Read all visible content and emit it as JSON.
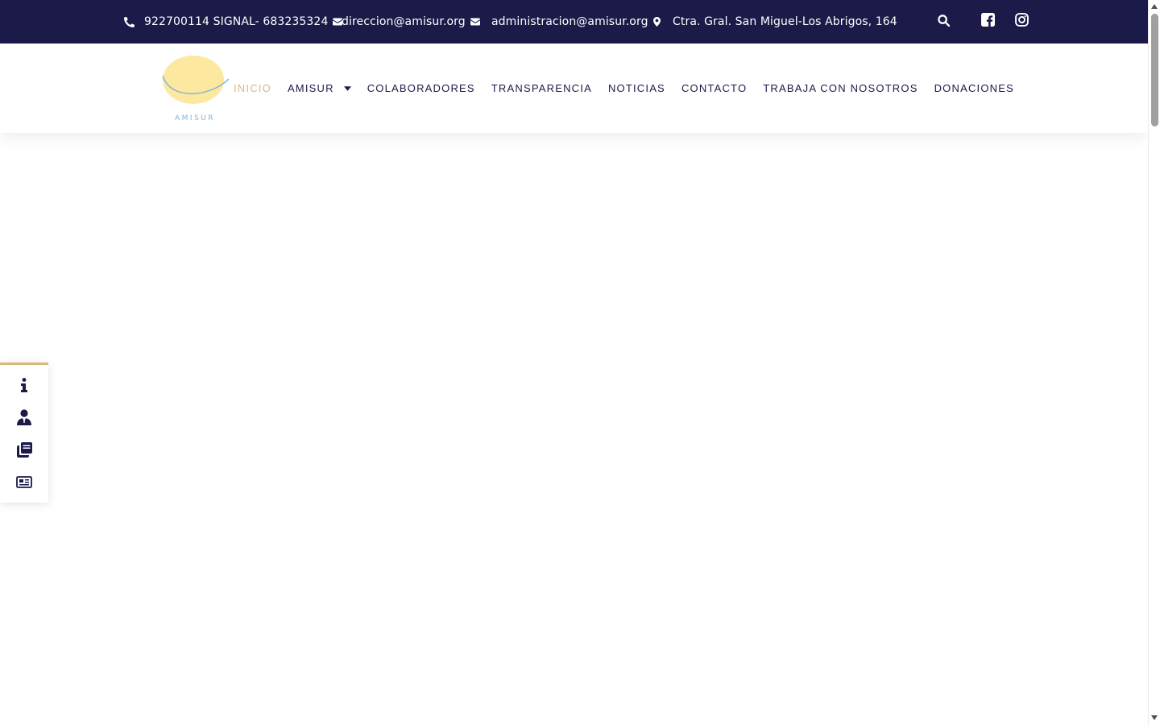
{
  "topbar": {
    "phone": "922700114  SIGNAL- 683235324",
    "email_direccion": "direccion@amisur.org",
    "email_administracion": "administracion@amisur.org",
    "address": "Ctra. Gral. San Miguel-Los Abrigos, 164",
    "icons": [
      "phone-icon",
      "envelope-icon",
      "envelope-icon",
      "map-marker-icon",
      "search-icon",
      "facebook-icon",
      "instagram-icon"
    ]
  },
  "logo": {
    "text": "AMISUR"
  },
  "nav": {
    "items": [
      {
        "label": "INICIO",
        "active": true
      },
      {
        "label": "AMISUR",
        "dropdown": true
      },
      {
        "label": "COLABORADORES"
      },
      {
        "label": "TRANSPARENCIA"
      },
      {
        "label": "NOTICIAS"
      },
      {
        "label": "CONTACTO"
      },
      {
        "label": "TRABAJA CON NOSOTROS"
      },
      {
        "label": "DONACIONES"
      }
    ]
  },
  "side_menu": {
    "icons": [
      "info-icon",
      "user-tie-icon",
      "copy-icon",
      "newspaper-icon"
    ]
  },
  "colors": {
    "navy": "#1b1a48",
    "gold": "#d8b978",
    "logo_yellow": "#fde89f",
    "logo_blue": "#7fb4de"
  }
}
